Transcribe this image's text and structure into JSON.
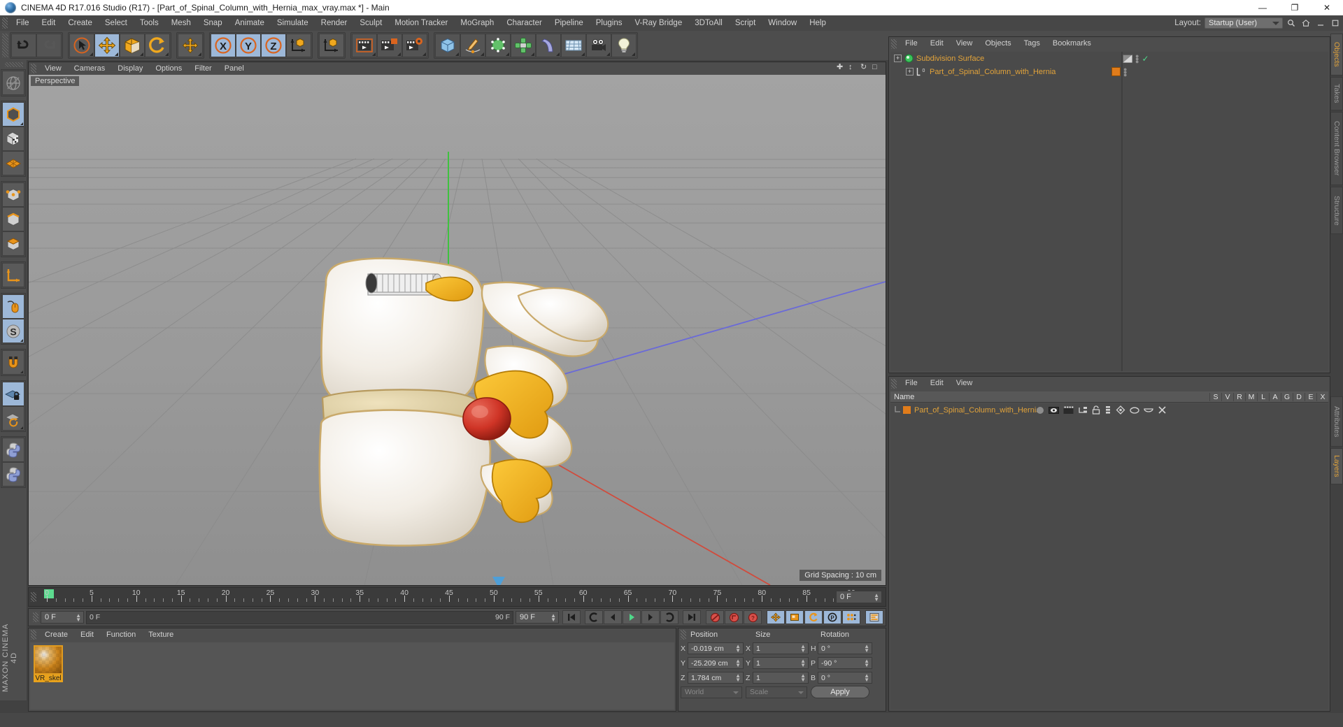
{
  "window": {
    "title": "CINEMA 4D R17.016 Studio (R17) - [Part_of_Spinal_Column_with_Hernia_max_vray.max *] - Main",
    "minimize": "—",
    "maximize": "❐",
    "close": "✕"
  },
  "menubar": {
    "items": [
      "File",
      "Edit",
      "Create",
      "Select",
      "Tools",
      "Mesh",
      "Snap",
      "Animate",
      "Simulate",
      "Render",
      "Sculpt",
      "Motion Tracker",
      "MoGraph",
      "Character",
      "Pipeline",
      "Plugins",
      "V-Ray Bridge",
      "3DToAll",
      "Script",
      "Window",
      "Help"
    ],
    "layout_label": "Layout:",
    "layout_value": "Startup (User)",
    "search_icon": "search-icon",
    "home_icon": "home-icon",
    "minimize_icon": "minimize-icon",
    "restore_icon": "restore-icon"
  },
  "viewport": {
    "menu": [
      "View",
      "Cameras",
      "Display",
      "Options",
      "Filter",
      "Panel"
    ],
    "perspective_label": "Perspective",
    "grid_spacing": "Grid Spacing : 10 cm",
    "axis_labels": {
      "y": "Y",
      "x": "X",
      "z": "Z"
    }
  },
  "timeline": {
    "ticks": [
      {
        "label": "0",
        "v": 0
      },
      {
        "label": "5",
        "v": 5
      },
      {
        "label": "10",
        "v": 10
      },
      {
        "label": "15",
        "v": 15
      },
      {
        "label": "20",
        "v": 20
      },
      {
        "label": "25",
        "v": 25
      },
      {
        "label": "30",
        "v": 30
      },
      {
        "label": "35",
        "v": 35
      },
      {
        "label": "40",
        "v": 40
      },
      {
        "label": "45",
        "v": 45
      },
      {
        "label": "50",
        "v": 50
      },
      {
        "label": "55",
        "v": 55
      },
      {
        "label": "60",
        "v": 60
      },
      {
        "label": "65",
        "v": 65
      },
      {
        "label": "70",
        "v": 70
      },
      {
        "label": "75",
        "v": 75
      },
      {
        "label": "80",
        "v": 80
      },
      {
        "label": "85",
        "v": 85
      },
      {
        "label": "90",
        "v": 90
      }
    ],
    "min_frame": 0,
    "max_frame": 90,
    "current_frame_field": "0 F"
  },
  "powerslider": {
    "current_frame": "0 F",
    "range_start": "0 F",
    "range_end": "90 F",
    "end_field": "90 F"
  },
  "material_manager": {
    "menu": [
      "Create",
      "Edit",
      "Function",
      "Texture"
    ],
    "materials": [
      {
        "name": "VR_skel",
        "color": "#e8a21c"
      }
    ]
  },
  "coordinates": {
    "headers": {
      "position": "Position",
      "size": "Size",
      "rotation": "Rotation"
    },
    "rows": [
      {
        "pos_axis": "X",
        "pos_value": "-0.019 cm",
        "size_axis": "X",
        "size_value": "1",
        "rot_axis": "H",
        "rot_value": "0 °"
      },
      {
        "pos_axis": "Y",
        "pos_value": "-25.209 cm",
        "size_axis": "Y",
        "size_value": "1",
        "rot_axis": "P",
        "rot_value": "-90 °"
      },
      {
        "pos_axis": "Z",
        "pos_value": "1.784 cm",
        "size_axis": "Z",
        "size_value": "1",
        "rot_axis": "B",
        "rot_value": "0 °"
      }
    ],
    "coord_system": "World",
    "mode": "Scale",
    "apply": "Apply"
  },
  "object_manager": {
    "menu": [
      "File",
      "Edit",
      "View",
      "Objects",
      "Tags",
      "Bookmarks"
    ],
    "rows": [
      {
        "name": "Subdivision Surface",
        "depth": 0,
        "icon": "subdivision-surface-icon",
        "check": "✓"
      },
      {
        "name": "Part_of_Spinal_Column_with_Hernia",
        "depth": 1,
        "icon": "polygon-object-icon",
        "tag_color": "#e07c1b"
      }
    ]
  },
  "layer_manager": {
    "menu": [
      "File",
      "Edit",
      "View"
    ],
    "name_header": "Name",
    "columns": [
      "S",
      "V",
      "R",
      "M",
      "L",
      "A",
      "G",
      "D",
      "E",
      "X"
    ],
    "rows": [
      {
        "name": "Part_of_Spinal_Column_with_Hernia",
        "color": "#e07c1b"
      }
    ]
  },
  "right_tabs": {
    "top": [
      "Objects",
      "Takes",
      "Content Browser",
      "Structure"
    ],
    "bottom": [
      "Attributes",
      "Layers"
    ],
    "active_top": "Objects",
    "active_bottom": "Layers"
  },
  "brand": {
    "maxon": "MAXON",
    "cinema4d": "CINEMA 4D"
  },
  "colors": {
    "accent_orange": "#e2a33a",
    "selection_blue": "#9db8d8",
    "panel_bg": "#4d4d4d",
    "viewport_bg": "#9b9b9b"
  }
}
